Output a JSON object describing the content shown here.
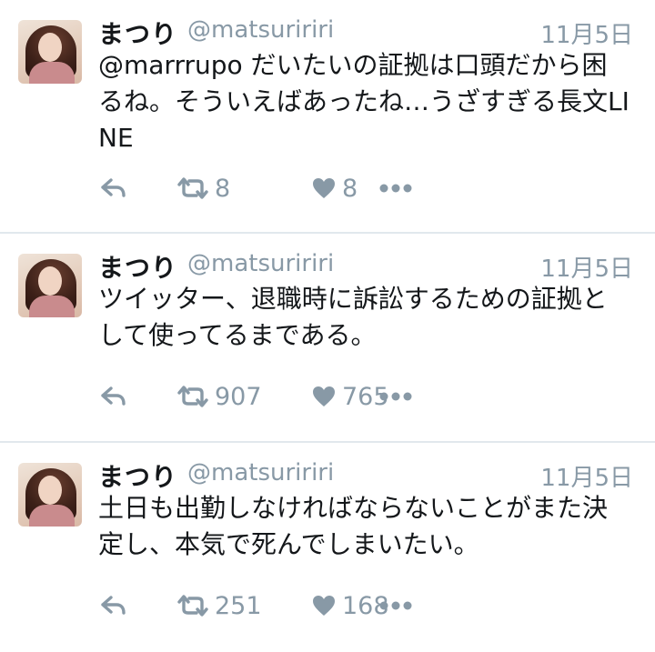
{
  "tweets": [
    {
      "name": "まつり",
      "handle": "@matsuririri",
      "date": "11月5日",
      "text": "@marrrupo だいたいの証拠は口頭だから困るね。そういえばあったね…うざすぎる長文LINE",
      "retweets": "8",
      "likes": "8"
    },
    {
      "name": "まつり",
      "handle": "@matsuririri",
      "date": "11月5日",
      "text": "ツイッター、退職時に訴訟するための証拠として使ってるまである。",
      "retweets": "907",
      "likes": "765"
    },
    {
      "name": "まつり",
      "handle": "@matsuririri",
      "date": "11月5日",
      "text": "土日も出勤しなければならないことがまた決定し、本気で死んでしまいたい。",
      "retweets": "251",
      "likes": "168"
    }
  ],
  "icons": {
    "reply": "reply-icon",
    "retweet": "retweet-icon",
    "like": "heart-icon",
    "more": "more-dots-icon"
  },
  "colors": {
    "meta": "#8899a6",
    "text": "#14171a",
    "divider": "#e1e8ed"
  }
}
